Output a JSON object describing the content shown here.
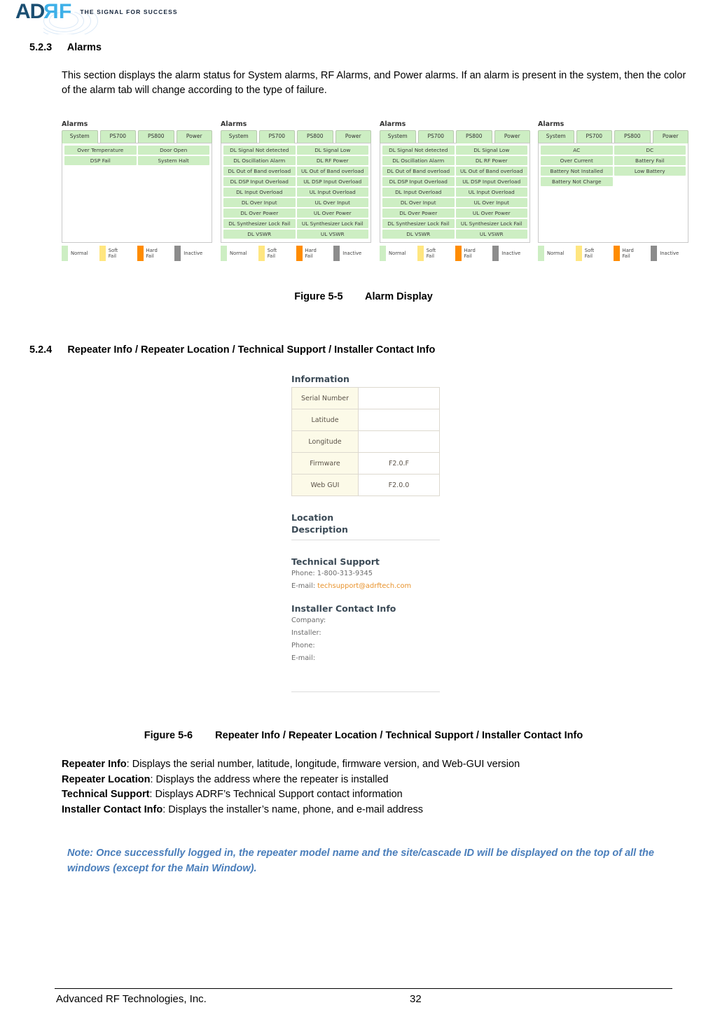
{
  "header": {
    "logo_ad": "AD",
    "logo_r": "R",
    "logo_f": "F",
    "tagline": "THE SIGNAL FOR SUCCESS"
  },
  "section_523": {
    "number": "5.2.3",
    "title": "Alarms",
    "paragraph": "This section displays the alarm status for System alarms, RF Alarms, and Power alarms.  If an alarm is present in the system, then the color of the alarm tab will change according to the type of failure."
  },
  "figure_5_5": {
    "caption_number": "Figure 5-5",
    "caption_text": "Alarm Display",
    "panel_title": "Alarms",
    "tabs": [
      "System",
      "PS700",
      "PS800",
      "Power"
    ],
    "legend": [
      {
        "label_line1": "Normal",
        "label_line2": "",
        "color": "#cdeec3"
      },
      {
        "label_line1": "Soft",
        "label_line2": "Fail",
        "color": "#ffe680"
      },
      {
        "label_line1": "Hard",
        "label_line2": "Fail",
        "color": "#ff8c00"
      },
      {
        "label_line1": "Inactive",
        "label_line2": "",
        "color": "#8c8c8c"
      }
    ],
    "panels": [
      {
        "active_tab": "System",
        "rows": [
          [
            "Over Temperature",
            "Door Open"
          ],
          [
            "DSP Fail",
            "System Halt"
          ]
        ]
      },
      {
        "active_tab": "PS700",
        "rows": [
          [
            "DL Signal Not detected",
            "DL Signal Low"
          ],
          [
            "DL Oscillation Alarm",
            "DL RF Power"
          ],
          [
            "DL Out of Band overload",
            "UL Out of Band overload"
          ],
          [
            "DL DSP Input Overload",
            "UL DSP Input Overload"
          ],
          [
            "DL Input Overload",
            "UL Input Overload"
          ],
          [
            "DL Over Input",
            "UL Over Input"
          ],
          [
            "DL Over Power",
            "UL Over Power"
          ],
          [
            "DL Synthesizer Lock Fail",
            "UL Synthesizer Lock Fail"
          ],
          [
            "DL VSWR",
            "UL VSWR"
          ]
        ]
      },
      {
        "active_tab": "PS800",
        "rows": [
          [
            "DL Signal Not detected",
            "DL Signal Low"
          ],
          [
            "DL Oscillation Alarm",
            "DL RF Power"
          ],
          [
            "DL Out of Band overload",
            "UL Out of Band overload"
          ],
          [
            "DL DSP Input Overload",
            "UL DSP Input Overload"
          ],
          [
            "DL Input Overload",
            "UL Input Overload"
          ],
          [
            "DL Over Input",
            "UL Over Input"
          ],
          [
            "DL Over Power",
            "UL Over Power"
          ],
          [
            "DL Synthesizer Lock Fail",
            "UL Synthesizer Lock Fail"
          ],
          [
            "DL VSWR",
            "UL VSWR"
          ]
        ]
      },
      {
        "active_tab": "Power",
        "rows": [
          [
            "AC",
            "DC"
          ],
          [
            "Over Current",
            "Battery Fail"
          ],
          [
            "Battery Not Installed",
            "Low Battery"
          ],
          [
            "Battery Not Charge",
            ""
          ]
        ]
      }
    ]
  },
  "section_524": {
    "number": "5.2.4",
    "title": "Repeater Info / Repeater Location / Technical Support / Installer Contact Info"
  },
  "figure_5_6": {
    "caption_number": "Figure 5-6",
    "caption_text": "Repeater Info / Repeater Location / Technical Support / Installer Contact Info",
    "information": {
      "heading": "Information",
      "rows": [
        {
          "label": "Serial Number",
          "value": ""
        },
        {
          "label": "Latitude",
          "value": ""
        },
        {
          "label": "Longitude",
          "value": ""
        },
        {
          "label": "Firmware",
          "value": "F2.0.F"
        },
        {
          "label": "Web GUI",
          "value": "F2.0.0"
        }
      ]
    },
    "location": {
      "heading_line1": "Location",
      "heading_line2": "Description"
    },
    "technical_support": {
      "heading": "Technical Support",
      "phone_label": "Phone:",
      "phone_value": "1-800-313-9345",
      "email_label": "E-mail:",
      "email_value": "techsupport@adrftech.com",
      "email_color": "#e8922b"
    },
    "installer_contact": {
      "heading": "Installer Contact Info",
      "fields": [
        "Company:",
        "Installer:",
        "Phone:",
        "E-mail:"
      ]
    }
  },
  "descriptions": [
    {
      "term": "Repeater Info",
      "text": ": Displays the serial number, latitude, longitude, firmware version, and Web-GUI version"
    },
    {
      "term": "Repeater Location",
      "text": ": Displays the address where the repeater is installed"
    },
    {
      "term": "Technical Support",
      "text": ": Displays ADRF’s Technical Support contact information"
    },
    {
      "term": "Installer Contact Info",
      "text": ": Displays the installer’s name, phone, and e-mail address"
    }
  ],
  "note": "Note: Once successfully logged in, the repeater model name and the site/cascade ID will be displayed on the top of all the windows (except for the Main Window).",
  "footer": {
    "company": "Advanced RF Technologies, Inc.",
    "page_number": "32"
  }
}
